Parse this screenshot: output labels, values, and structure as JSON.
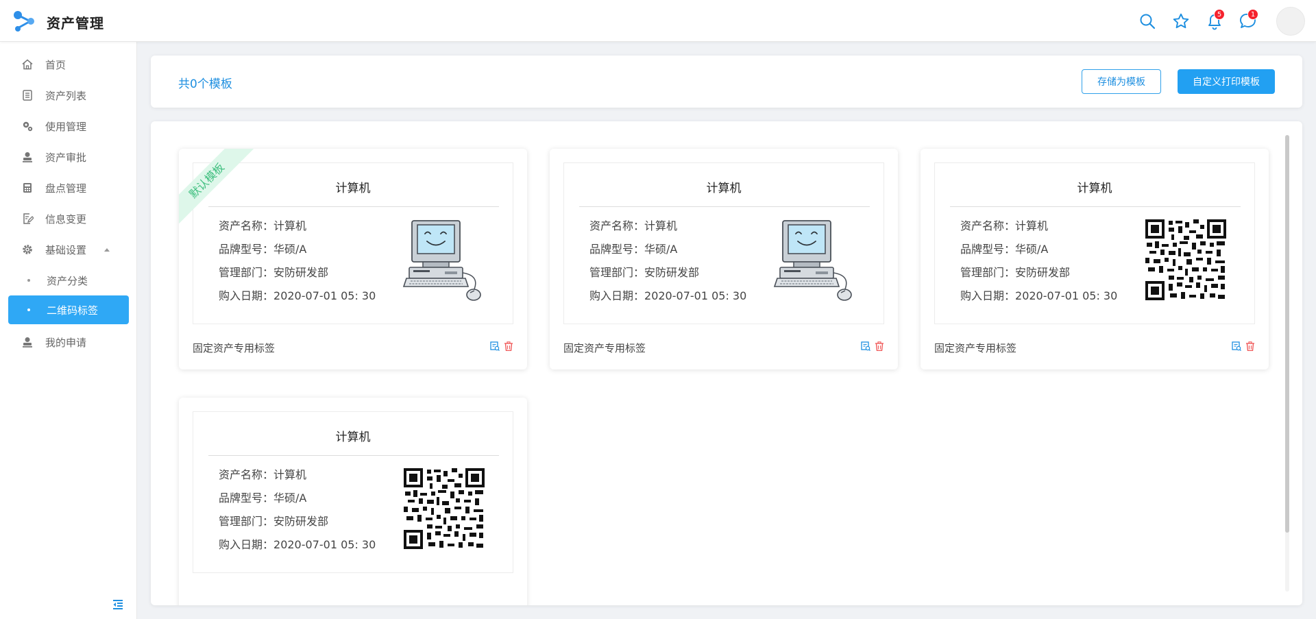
{
  "app": {
    "title": "资产管理"
  },
  "header": {
    "icons": [
      {
        "name": "search-icon"
      },
      {
        "name": "star-icon"
      },
      {
        "name": "bell-icon",
        "badge": "5"
      },
      {
        "name": "chat-icon",
        "badge": "1"
      }
    ]
  },
  "sidebar": {
    "items": [
      {
        "label": "首页",
        "icon": "home-icon"
      },
      {
        "label": "资产列表",
        "icon": "list-icon"
      },
      {
        "label": "使用管理",
        "icon": "gears-icon"
      },
      {
        "label": "资产审批",
        "icon": "user-stamp-icon"
      },
      {
        "label": "盘点管理",
        "icon": "calculator-icon"
      },
      {
        "label": "信息变更",
        "icon": "edit-doc-icon"
      },
      {
        "label": "基础设置",
        "icon": "settings-icon",
        "expanded": true
      },
      {
        "label": "资产分类",
        "sub": true
      },
      {
        "label": "二维码标签",
        "sub": true,
        "active": true
      },
      {
        "label": "我的申请",
        "icon": "user-stamp-icon"
      }
    ],
    "collapse_icon": "collapse-menu-icon"
  },
  "toolbar": {
    "count_text": "共0个模板",
    "save_as_template": "存储为模板",
    "custom_print_template": "自定义打印模板"
  },
  "cards": [
    {
      "title": "计算机",
      "ribbon": "默认模板",
      "fields": [
        {
          "k": "资产名称：",
          "v": "计算机"
        },
        {
          "k": "品牌型号：",
          "v": "华硕/A"
        },
        {
          "k": "管理部门：",
          "v": "安防研发部"
        },
        {
          "k": "购入日期：",
          "v": "2020-07-01 05: 30"
        }
      ],
      "image": "computer-illustration",
      "footer": "固定资产专用标签"
    },
    {
      "title": "计算机",
      "fields": [
        {
          "k": "资产名称：",
          "v": "计算机"
        },
        {
          "k": "品牌型号：",
          "v": "华硕/A"
        },
        {
          "k": "管理部门：",
          "v": "安防研发部"
        },
        {
          "k": "购入日期：",
          "v": "2020-07-01 05: 30"
        }
      ],
      "image": "computer-illustration",
      "footer": "固定资产专用标签"
    },
    {
      "title": "计算机",
      "fields": [
        {
          "k": "资产名称：",
          "v": "计算机"
        },
        {
          "k": "品牌型号：",
          "v": "华硕/A"
        },
        {
          "k": "管理部门：",
          "v": "安防研发部"
        },
        {
          "k": "购入日期：",
          "v": "2020-07-01 05: 30"
        }
      ],
      "image": "qr-code",
      "footer": "固定资产专用标签"
    },
    {
      "title": "计算机",
      "fields": [
        {
          "k": "资产名称：",
          "v": "计算机"
        },
        {
          "k": "品牌型号：",
          "v": "华硕/A"
        },
        {
          "k": "管理部门：",
          "v": "安防研发部"
        },
        {
          "k": "购入日期：",
          "v": "2020-07-01 05: 30"
        }
      ],
      "image": "qr-code",
      "footer": ""
    }
  ],
  "colors": {
    "accent": "#22a0f2",
    "delete": "#f05b5b",
    "ribbon": "#3fbf7f"
  }
}
